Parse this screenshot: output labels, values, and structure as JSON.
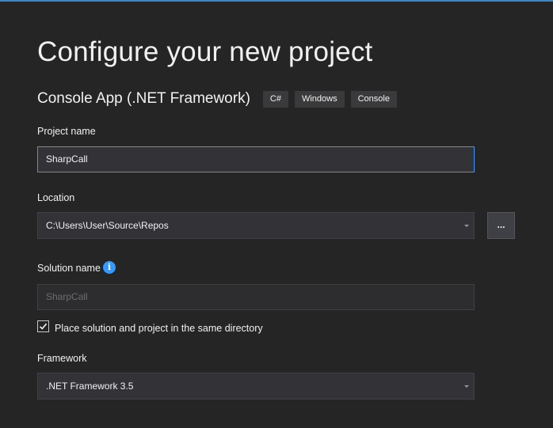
{
  "header": {
    "title": "Configure your new project",
    "template_name": "Console App (.NET Framework)",
    "tags": [
      "C#",
      "Windows",
      "Console"
    ]
  },
  "project_name": {
    "label": "Project name",
    "value": "SharpCall"
  },
  "location": {
    "label": "Location",
    "value": "C:\\Users\\User\\Source\\Repos",
    "browse_label": "..."
  },
  "solution_name": {
    "label": "Solution name",
    "value": "SharpCall",
    "info_icon": "info-icon"
  },
  "same_directory": {
    "label": "Place solution and project in the same directory",
    "checked": true
  },
  "framework": {
    "label": "Framework",
    "value": ".NET Framework 3.5"
  },
  "colors": {
    "background": "#252526",
    "accent": "#3399ff",
    "input_background": "#333337"
  }
}
